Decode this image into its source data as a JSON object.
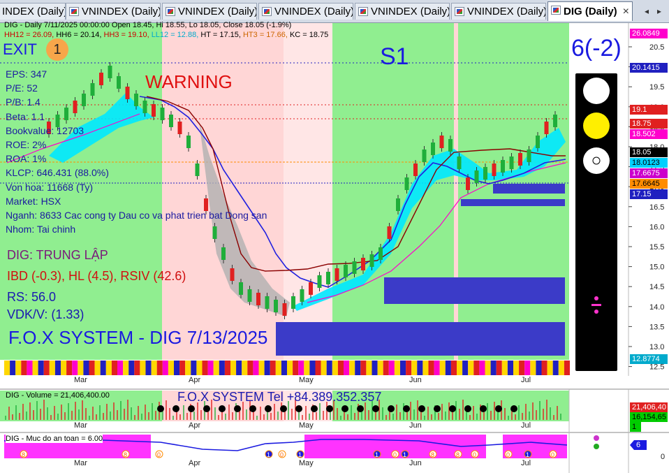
{
  "tabs": [
    {
      "label": "INDEX (Daily)"
    },
    {
      "label": "VNINDEX (Daily)"
    },
    {
      "label": "VNINDEX (Daily)"
    },
    {
      "label": "VNINDEX (Daily)"
    },
    {
      "label": "VNINDEX (Daily)"
    },
    {
      "label": "VNINDEX (Daily)"
    },
    {
      "label": "DIG (Daily)",
      "active": true
    }
  ],
  "tab_close": "×",
  "tab_nav_left": "◂",
  "tab_nav_right": "▸",
  "header": {
    "line1": "DIG - Daily 7/11/2025 00:00:00 Open 18.45, Hi 18.55, Lo 18.05, Close 18.05 (-1.9%)",
    "line2": [
      {
        "text": "HH12 = 26.09",
        "color": "#cc0000"
      },
      {
        "text": "HH6 = 20.14",
        "color": "#000000"
      },
      {
        "text": "HH3 = 19.10",
        "color": "#cc0000"
      },
      {
        "text": "LL12 = 12.88",
        "color": "#00aacc"
      },
      {
        "text": "HT = 17.15",
        "color": "#000000"
      },
      {
        "text": "HT3 = 17.66",
        "color": "#cc6600"
      },
      {
        "text": "KC = 18.75",
        "color": "#000000"
      }
    ]
  },
  "left_panel": {
    "exit": "EXIT",
    "exit_badge": "1",
    "warning": "WARNING",
    "signal": "S1",
    "rating": "6(-2)",
    "info": [
      "EPS: 347",
      "P/E: 52",
      "P/B: 1.4",
      "Beta: 1.1",
      "Bookvalue: 12703",
      "ROE: 2%",
      "ROA: 1%",
      "KLCP: 646.431 (88.0%)",
      "Von hoa: 11668 (Ty)",
      "Market: HSX",
      "Nganh: 8633 Cac cong ty Dau co va phat trien bat Dong san",
      "Nhom: Tai chinh"
    ],
    "status": "DIG: TRUNG LẬP",
    "ibd": "IBD (-0.3), HL (4.5), RSIV (42.6)",
    "rs": "RS: 56.0",
    "vdk": "VDK/V:  (1.33)",
    "system_title": "F.O.X SYSTEM - DIG 7/13/2025"
  },
  "price_axis": {
    "ticks": [
      "20.5",
      "20.0",
      "19.5",
      "19.0",
      "18.5",
      "18.0",
      "17.5",
      "17.0",
      "16.5",
      "16.0",
      "15.5",
      "15.0",
      "14.5",
      "14.0",
      "13.5",
      "13.0",
      "12.5"
    ],
    "badges": [
      {
        "text": "26.0849",
        "bg": "#ff00cc",
        "fg": "#ffffff"
      },
      {
        "text": "20.1415",
        "bg": "#2020c0",
        "fg": "#ffffff"
      },
      {
        "text": "19.1",
        "bg": "#e02020",
        "fg": "#ffffff"
      },
      {
        "text": "18.75",
        "bg": "#e02020",
        "fg": "#ffffff"
      },
      {
        "text": "18.502",
        "bg": "#ff00cc",
        "fg": "#ffffff"
      },
      {
        "text": "18.05",
        "bg": "#000000",
        "fg": "#ffffff"
      },
      {
        "text": "18.0123",
        "bg": "#00d0ff",
        "fg": "#000000"
      },
      {
        "text": "17.6675",
        "bg": "#cc00cc",
        "fg": "#ffffff"
      },
      {
        "text": "17.6645",
        "bg": "#ff8c00",
        "fg": "#000000"
      },
      {
        "text": "17.15",
        "bg": "#2020c0",
        "fg": "#ffffff"
      },
      {
        "text": "12.8774",
        "bg": "#00aacc",
        "fg": "#ffffff"
      }
    ]
  },
  "months": [
    "Mar",
    "Apr",
    "May",
    "Jun",
    "Jul"
  ],
  "volume_panel": {
    "label": "DIG - Volume = 21,406,400.00",
    "contact": "F.O.X SYSTEM Tel +84.389.352.357",
    "badges": [
      {
        "text": "21,406,40",
        "bg": "#e02020",
        "fg": "#ffffff"
      },
      {
        "text": "16,154,65",
        "bg": "#00cc00",
        "fg": "#000000"
      },
      {
        "text": "1",
        "bg": "#00cc00",
        "fg": "#000000"
      }
    ]
  },
  "safety_panel": {
    "label": "DIG - Muc do an toan = 6.00",
    "value_badge": "6",
    "zero": "0",
    "markers": [
      "8",
      "8",
      "0",
      "1",
      "1",
      "1",
      "0",
      "1",
      "8",
      "8",
      "0",
      "0",
      "1",
      "0",
      "0"
    ]
  },
  "colors": {
    "green": "#90ee90",
    "pink": "#ffd6d6",
    "blue": "#2020c0",
    "cyan": "#00e8ff",
    "magenta": "#ff00cc"
  }
}
